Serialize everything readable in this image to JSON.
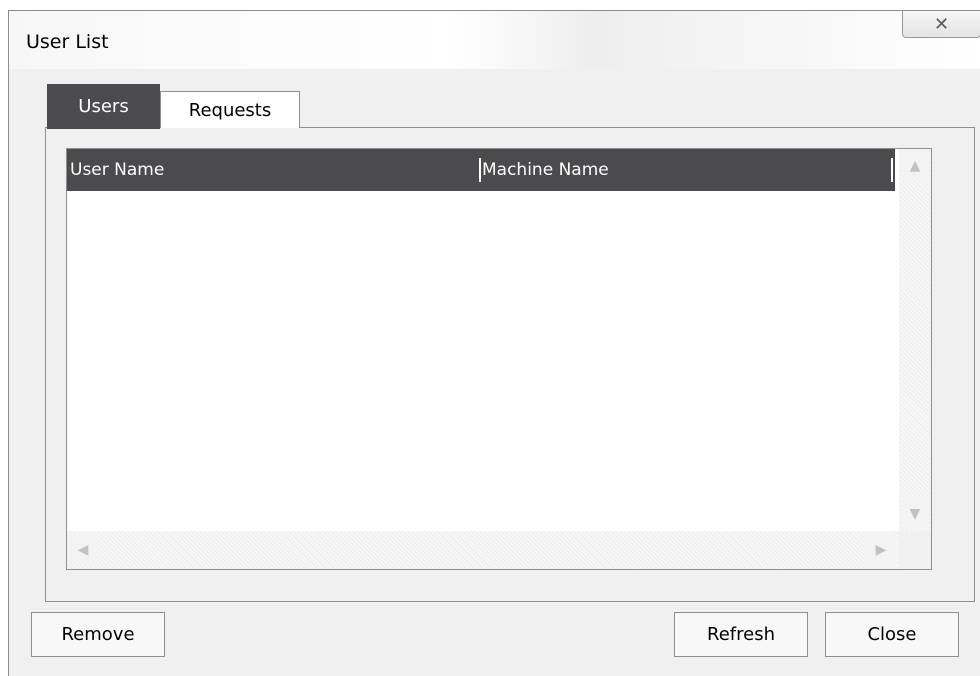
{
  "window": {
    "title": "User List",
    "close_glyph": "✕"
  },
  "tabs": [
    {
      "label": "Users",
      "selected": true
    },
    {
      "label": "Requests",
      "selected": false
    }
  ],
  "list": {
    "columns": [
      "User Name",
      "Machine Name"
    ],
    "rows": []
  },
  "scrollbars": {
    "up_arrow": "▲",
    "down_arrow": "▼",
    "left_arrow": "◀",
    "right_arrow": "▶"
  },
  "buttons": {
    "remove": "Remove",
    "refresh": "Refresh",
    "close": "Close"
  },
  "colors": {
    "header_bg": "#4b4b4d",
    "header_text": "#ffffff",
    "window_bg": "#f0f0f0"
  }
}
